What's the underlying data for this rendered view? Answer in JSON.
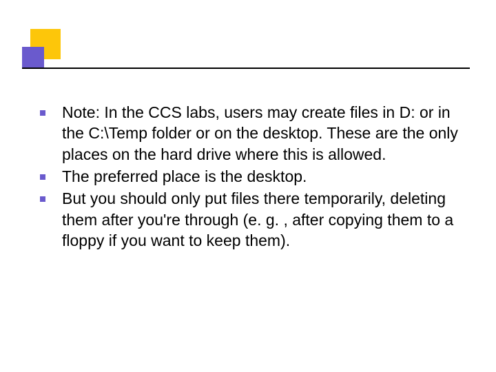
{
  "slide": {
    "bullets": [
      "Note: In the CCS labs, users may create files in D: or in the C:\\Temp folder or on the desktop.  These are the only places on the hard drive where this is allowed.",
      "The preferred place is the desktop.",
      "But you should only put files there temporarily, deleting them after you're through (e. g. , after copying them to a floppy if you want to keep them)."
    ]
  }
}
